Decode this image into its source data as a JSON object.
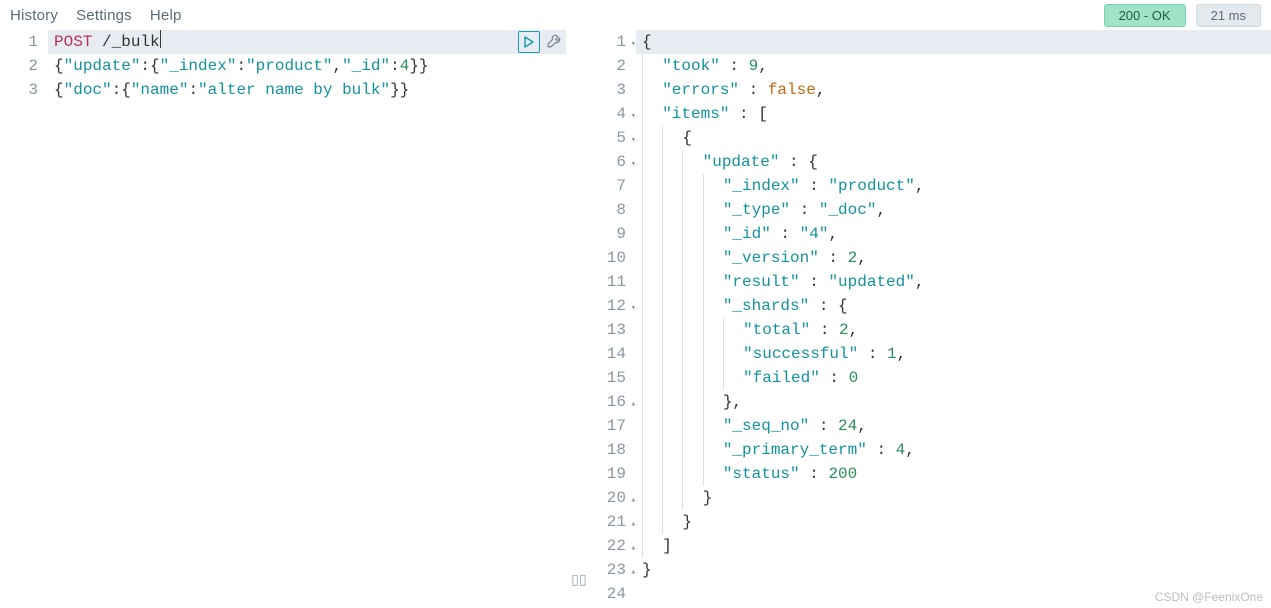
{
  "menu": {
    "history": "History",
    "settings": "Settings",
    "help": "Help"
  },
  "status": {
    "ok": "200 - OK",
    "time": "21 ms"
  },
  "splitter_glyph": "▯▯",
  "request": {
    "lines": [
      {
        "n": "1",
        "hl": true,
        "tokens": [
          [
            "method",
            "POST"
          ],
          [
            "punc",
            " /_bulk"
          ],
          [
            "cursor",
            ""
          ]
        ]
      },
      {
        "n": "2",
        "tokens": [
          [
            "punc",
            "{"
          ],
          [
            "key",
            "\"update\""
          ],
          [
            "punc",
            ":{"
          ],
          [
            "key",
            "\"_index\""
          ],
          [
            "punc",
            ":"
          ],
          [
            "str",
            "\"product\""
          ],
          [
            "punc",
            ","
          ],
          [
            "key",
            "\"_id\""
          ],
          [
            "punc",
            ":"
          ],
          [
            "num",
            "4"
          ],
          [
            "punc",
            "}}"
          ]
        ]
      },
      {
        "n": "3",
        "tokens": [
          [
            "punc",
            "{"
          ],
          [
            "key",
            "\"doc\""
          ],
          [
            "punc",
            ":{"
          ],
          [
            "key",
            "\"name\""
          ],
          [
            "punc",
            ":"
          ],
          [
            "str",
            "\"alter name by bulk\""
          ],
          [
            "punc",
            "}}"
          ]
        ]
      }
    ]
  },
  "response": {
    "lines": [
      {
        "n": "1",
        "fold": "▾",
        "hl": true,
        "indent": 0,
        "tokens": [
          [
            "punc",
            "{"
          ]
        ]
      },
      {
        "n": "2",
        "indent": 1,
        "tokens": [
          [
            "key",
            "\"took\""
          ],
          [
            "punc",
            " : "
          ],
          [
            "num",
            "9"
          ],
          [
            "punc",
            ","
          ]
        ]
      },
      {
        "n": "3",
        "indent": 1,
        "tokens": [
          [
            "key",
            "\"errors\""
          ],
          [
            "punc",
            " : "
          ],
          [
            "bool",
            "false"
          ],
          [
            "punc",
            ","
          ]
        ]
      },
      {
        "n": "4",
        "fold": "▾",
        "indent": 1,
        "tokens": [
          [
            "key",
            "\"items\""
          ],
          [
            "punc",
            " : ["
          ]
        ]
      },
      {
        "n": "5",
        "fold": "▾",
        "indent": 2,
        "tokens": [
          [
            "punc",
            "{"
          ]
        ]
      },
      {
        "n": "6",
        "fold": "▾",
        "indent": 3,
        "tokens": [
          [
            "key",
            "\"update\""
          ],
          [
            "punc",
            " : {"
          ]
        ]
      },
      {
        "n": "7",
        "indent": 4,
        "tokens": [
          [
            "key",
            "\"_index\""
          ],
          [
            "punc",
            " : "
          ],
          [
            "str",
            "\"product\""
          ],
          [
            "punc",
            ","
          ]
        ]
      },
      {
        "n": "8",
        "indent": 4,
        "tokens": [
          [
            "key",
            "\"_type\""
          ],
          [
            "punc",
            " : "
          ],
          [
            "str",
            "\"_doc\""
          ],
          [
            "punc",
            ","
          ]
        ]
      },
      {
        "n": "9",
        "indent": 4,
        "tokens": [
          [
            "key",
            "\"_id\""
          ],
          [
            "punc",
            " : "
          ],
          [
            "str",
            "\"4\""
          ],
          [
            "punc",
            ","
          ]
        ]
      },
      {
        "n": "10",
        "indent": 4,
        "tokens": [
          [
            "key",
            "\"_version\""
          ],
          [
            "punc",
            " : "
          ],
          [
            "num",
            "2"
          ],
          [
            "punc",
            ","
          ]
        ]
      },
      {
        "n": "11",
        "indent": 4,
        "tokens": [
          [
            "key",
            "\"result\""
          ],
          [
            "punc",
            " : "
          ],
          [
            "str",
            "\"updated\""
          ],
          [
            "punc",
            ","
          ]
        ]
      },
      {
        "n": "12",
        "fold": "▾",
        "indent": 4,
        "tokens": [
          [
            "key",
            "\"_shards\""
          ],
          [
            "punc",
            " : {"
          ]
        ]
      },
      {
        "n": "13",
        "indent": 5,
        "tokens": [
          [
            "key",
            "\"total\""
          ],
          [
            "punc",
            " : "
          ],
          [
            "num",
            "2"
          ],
          [
            "punc",
            ","
          ]
        ]
      },
      {
        "n": "14",
        "indent": 5,
        "tokens": [
          [
            "key",
            "\"successful\""
          ],
          [
            "punc",
            " : "
          ],
          [
            "num",
            "1"
          ],
          [
            "punc",
            ","
          ]
        ]
      },
      {
        "n": "15",
        "indent": 5,
        "tokens": [
          [
            "key",
            "\"failed\""
          ],
          [
            "punc",
            " : "
          ],
          [
            "num",
            "0"
          ]
        ]
      },
      {
        "n": "16",
        "fold": "▴",
        "indent": 4,
        "tokens": [
          [
            "punc",
            "},"
          ]
        ]
      },
      {
        "n": "17",
        "indent": 4,
        "tokens": [
          [
            "key",
            "\"_seq_no\""
          ],
          [
            "punc",
            " : "
          ],
          [
            "num",
            "24"
          ],
          [
            "punc",
            ","
          ]
        ]
      },
      {
        "n": "18",
        "indent": 4,
        "tokens": [
          [
            "key",
            "\"_primary_term\""
          ],
          [
            "punc",
            " : "
          ],
          [
            "num",
            "4"
          ],
          [
            "punc",
            ","
          ]
        ]
      },
      {
        "n": "19",
        "indent": 4,
        "tokens": [
          [
            "key",
            "\"status\""
          ],
          [
            "punc",
            " : "
          ],
          [
            "num",
            "200"
          ]
        ]
      },
      {
        "n": "20",
        "fold": "▴",
        "indent": 3,
        "tokens": [
          [
            "punc",
            "}"
          ]
        ]
      },
      {
        "n": "21",
        "fold": "▴",
        "indent": 2,
        "tokens": [
          [
            "punc",
            "}"
          ]
        ]
      },
      {
        "n": "22",
        "fold": "▴",
        "indent": 1,
        "tokens": [
          [
            "punc",
            "]"
          ]
        ]
      },
      {
        "n": "23",
        "fold": "▴",
        "indent": 0,
        "tokens": [
          [
            "punc",
            "}"
          ]
        ]
      },
      {
        "n": "24",
        "indent": 0,
        "tokens": []
      }
    ]
  },
  "watermark": "CSDN @FeenixOne"
}
